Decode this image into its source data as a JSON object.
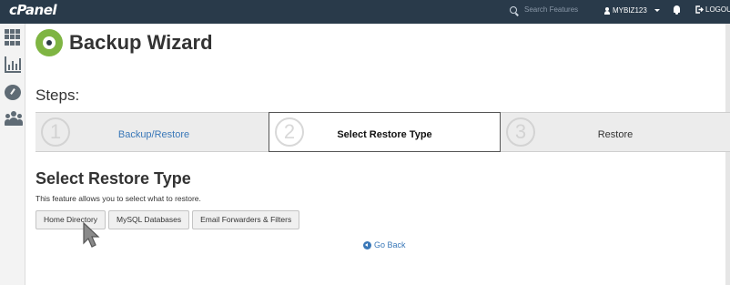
{
  "topbar": {
    "logo": "cPanel",
    "search_placeholder": "Search Features",
    "username": "MYBIZ123",
    "logout_label": "LOGOU"
  },
  "sidebar": {
    "icons": [
      "apps-grid-icon",
      "stats-chart-icon",
      "dashboard-gauge-icon",
      "users-icon"
    ]
  },
  "header": {
    "icon": "backup-wizard-icon",
    "title": "Backup Wizard"
  },
  "steps": {
    "label": "Steps:",
    "items": [
      {
        "number": "1",
        "label": "Backup/Restore",
        "state": "link"
      },
      {
        "number": "2",
        "label": "Select Restore Type",
        "state": "current"
      },
      {
        "number": "3",
        "label": "Restore",
        "state": "upcoming"
      }
    ]
  },
  "section": {
    "title": "Select Restore Type",
    "description": "This feature allows you to select what to restore."
  },
  "buttons": {
    "home_directory": "Home Directory",
    "mysql_databases": "MySQL Databases",
    "email_forwarders": "Email Forwarders & Filters"
  },
  "go_back": "Go Back",
  "colors": {
    "topbar": "#293a4a",
    "link": "#3a78b8",
    "icon_green": "#7fb543"
  }
}
